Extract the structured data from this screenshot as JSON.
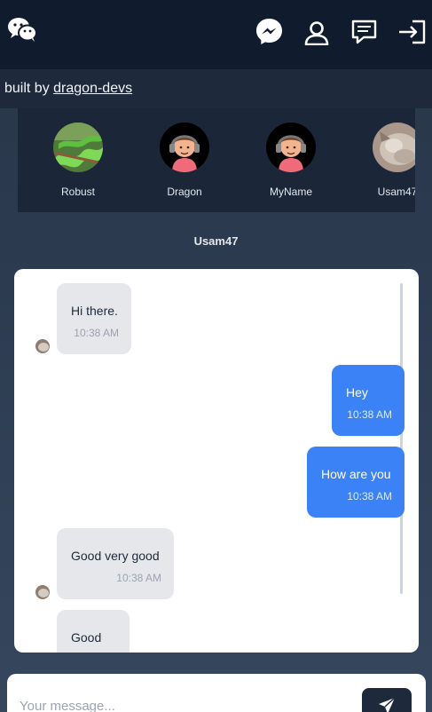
{
  "header": {
    "logo_icon": "wechat-icon",
    "icons": [
      "messenger-icon",
      "user-icon",
      "chat-box-icon",
      "login-icon"
    ]
  },
  "credit": {
    "prefix": "built by",
    "link": "dragon-devs"
  },
  "users": [
    {
      "name": "Robust",
      "avatar": "snake-photo"
    },
    {
      "name": "Dragon",
      "avatar": "cartoon-headphones-avatar"
    },
    {
      "name": "MyName",
      "avatar": "cartoon-headphones-avatar"
    },
    {
      "name": "Usam47",
      "avatar": "cat-photo"
    }
  ],
  "chat": {
    "title": "Usam47",
    "messages": [
      {
        "direction": "in",
        "text": "Hi there.",
        "time": "10:38 AM"
      },
      {
        "direction": "out",
        "text": "Hey",
        "time": "10:38 AM"
      },
      {
        "direction": "out",
        "text": "How are you",
        "time": "10:38 AM"
      },
      {
        "direction": "in",
        "text": "Good very good",
        "time": "10:38 AM"
      },
      {
        "direction": "in",
        "text": "Good",
        "time": ""
      }
    ]
  },
  "composer": {
    "placeholder": "Your message...",
    "send_icon": "send-icon"
  },
  "colors": {
    "topbar": "#111b2e",
    "outgoing_bubble": "#3b82f6",
    "incoming_bubble": "#e5e7eb",
    "send_button": "#1e293b"
  }
}
